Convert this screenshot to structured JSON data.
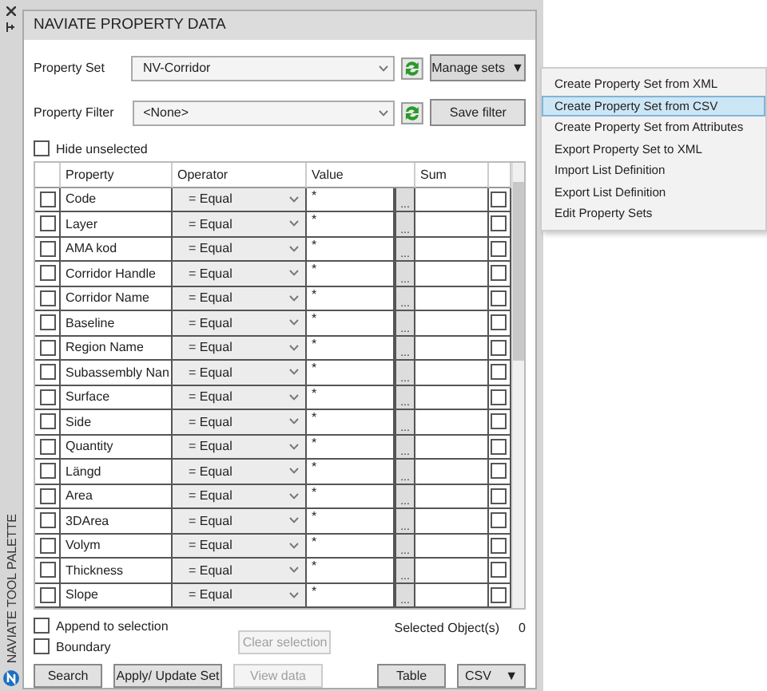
{
  "palette": {
    "title": "NAVIATE TOOL PALETTE"
  },
  "panel": {
    "title": "NAVIATE PROPERTY DATA"
  },
  "property_set": {
    "label": "Property Set",
    "value": "NV-Corridor",
    "button": "Manage sets",
    "caret": "▼"
  },
  "property_filter": {
    "label": "Property Filter",
    "value": "<None>",
    "button": "Save filter"
  },
  "hide_unselected": {
    "label": "Hide unselected",
    "checked": false
  },
  "table": {
    "columns": [
      "Property",
      "Operator",
      "Value",
      "Sum"
    ],
    "rows": [
      {
        "property": "Code",
        "operator": "= Equal",
        "value": "*",
        "button": "...",
        "checked": false,
        "sum_checked": false
      },
      {
        "property": "Layer",
        "operator": "= Equal",
        "value": "*",
        "button": "...",
        "checked": false,
        "sum_checked": false
      },
      {
        "property": "AMA kod",
        "operator": "= Equal",
        "value": "*",
        "button": "...",
        "checked": false,
        "sum_checked": false
      },
      {
        "property": "Corridor Handle",
        "operator": "= Equal",
        "value": "*",
        "button": "...",
        "checked": false,
        "sum_checked": false
      },
      {
        "property": "Corridor Name",
        "operator": "= Equal",
        "value": "*",
        "button": "...",
        "checked": false,
        "sum_checked": false
      },
      {
        "property": "Baseline",
        "operator": "= Equal",
        "value": "*",
        "button": "...",
        "checked": false,
        "sum_checked": false
      },
      {
        "property": "Region Name",
        "operator": "= Equal",
        "value": "*",
        "button": "...",
        "checked": false,
        "sum_checked": false
      },
      {
        "property": "Subassembly Nan",
        "operator": "= Equal",
        "value": "*",
        "button": "...",
        "checked": false,
        "sum_checked": false
      },
      {
        "property": "Surface",
        "operator": "= Equal",
        "value": "*",
        "button": "...",
        "checked": false,
        "sum_checked": false
      },
      {
        "property": "Side",
        "operator": "= Equal",
        "value": "*",
        "button": "...",
        "checked": false,
        "sum_checked": false
      },
      {
        "property": "Quantity",
        "operator": "= Equal",
        "value": "*",
        "button": "...",
        "checked": false,
        "sum_checked": false
      },
      {
        "property": "Längd",
        "operator": "= Equal",
        "value": "*",
        "button": "...",
        "checked": false,
        "sum_checked": false
      },
      {
        "property": "Area",
        "operator": "= Equal",
        "value": "*",
        "button": "...",
        "checked": false,
        "sum_checked": false
      },
      {
        "property": "3DArea",
        "operator": "= Equal",
        "value": "*",
        "button": "...",
        "checked": false,
        "sum_checked": false
      },
      {
        "property": "Volym",
        "operator": "= Equal",
        "value": "*",
        "button": "...",
        "checked": false,
        "sum_checked": false
      },
      {
        "property": "Thickness",
        "operator": "= Equal",
        "value": "*",
        "button": "...",
        "checked": false,
        "sum_checked": false
      },
      {
        "property": "Slope",
        "operator": "= Equal",
        "value": "*",
        "button": "...",
        "checked": false,
        "sum_checked": false
      }
    ]
  },
  "options": [
    {
      "label": "Append to selection",
      "checked": false
    },
    {
      "label": "Boundary",
      "checked": false
    }
  ],
  "selected_objects": {
    "label": "Selected Object(s)",
    "count": "0"
  },
  "buttons": [
    {
      "label": "Clear selection",
      "disabled": true
    }
  ],
  "footer_buttons": [
    {
      "label": "Search",
      "disabled": false
    },
    {
      "label": "Apply/ Update Set",
      "disabled": false
    },
    {
      "label": "View data",
      "disabled": true
    }
  ],
  "right_buttons": [
    {
      "label": "Table"
    },
    {
      "label": "CSV",
      "caret": "▼"
    }
  ],
  "menu": {
    "items": [
      {
        "label": "Create Property Set from XML",
        "selected": false
      },
      {
        "label": "Create Property Set from CSV",
        "selected": true
      },
      {
        "label": "Create Property Set from Attributes",
        "selected": false
      },
      {
        "label": "Export Property Set to XML",
        "selected": false
      },
      {
        "label": "Import List Definition",
        "selected": false
      },
      {
        "label": "Export List Definition",
        "selected": false
      },
      {
        "label": "Edit Property Sets",
        "selected": false
      }
    ]
  }
}
